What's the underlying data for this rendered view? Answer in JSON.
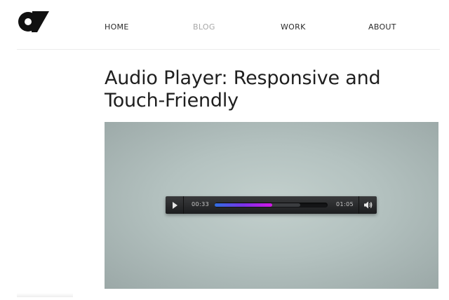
{
  "brand": {
    "logo_icon": "brand-logo-mark",
    "logo_color": "#111111"
  },
  "nav": {
    "items": [
      {
        "label": "HOME",
        "active": false
      },
      {
        "label": "BLOG",
        "active": true
      },
      {
        "label": "WORK",
        "active": false
      },
      {
        "label": "ABOUT",
        "active": false
      }
    ]
  },
  "article": {
    "title": "Audio Player: Responsive and Touch-Friendly"
  },
  "player": {
    "current_time": "00:33",
    "total_time": "01:05",
    "progress_fraction": 0.51,
    "buffered_fraction": 0.76,
    "play_icon": "play-icon",
    "volume_icon": "speaker-volume-icon",
    "progress_colors": [
      "#2f6fe0",
      "#7a33e8",
      "#d217e6"
    ]
  }
}
